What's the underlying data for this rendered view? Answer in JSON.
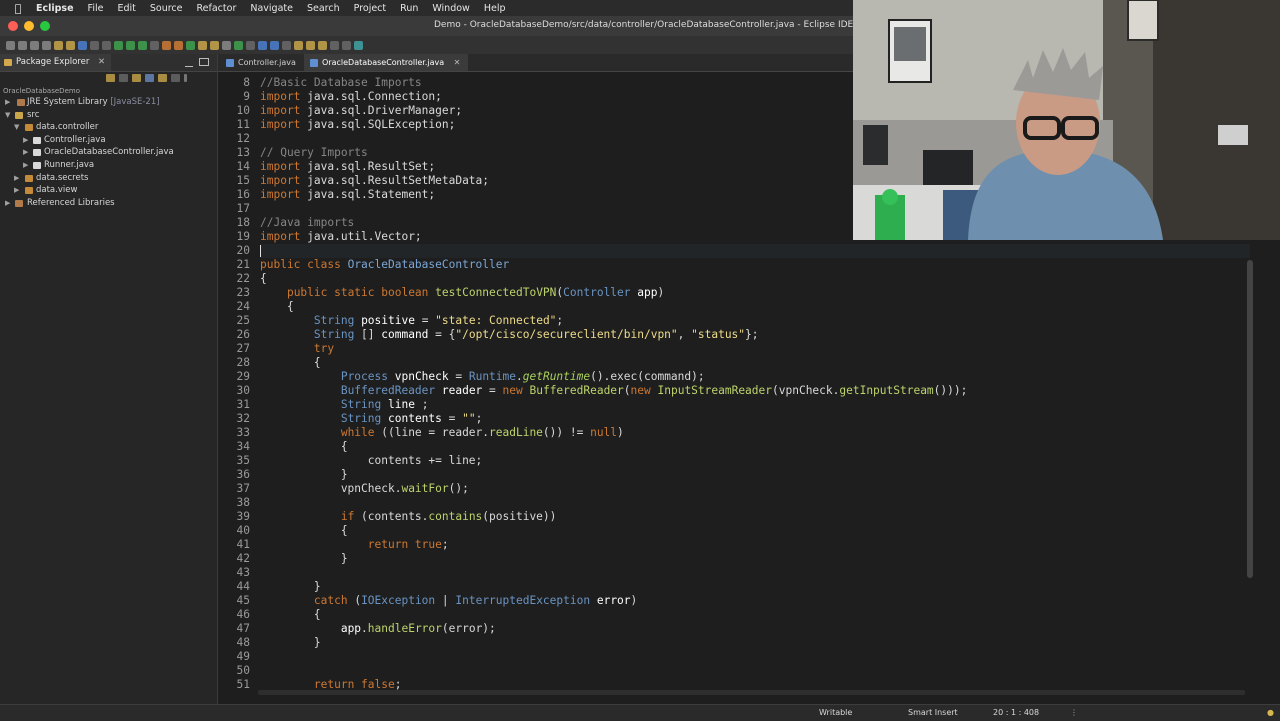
{
  "menubar": {
    "app": "Eclipse",
    "items": [
      "File",
      "Edit",
      "Source",
      "Refactor",
      "Navigate",
      "Search",
      "Project",
      "Run",
      "Window",
      "Help"
    ]
  },
  "window": {
    "title": "Demo - OracleDatabaseDemo/src/data/controller/OracleDatabaseController.java - Eclipse IDE"
  },
  "package_explorer": {
    "tab_label": "Package Explorer",
    "project": "OracleDatabaseDemo",
    "tree": [
      {
        "label": "JRE System Library",
        "suffix": "[JavaSE-21]"
      },
      {
        "label": "src"
      },
      {
        "label": "data.controller"
      },
      {
        "label": "Controller.java"
      },
      {
        "label": "OracleDatabaseController.java"
      },
      {
        "label": "Runner.java"
      },
      {
        "label": "data.secrets"
      },
      {
        "label": "data.view"
      },
      {
        "label": "Referenced Libraries"
      }
    ]
  },
  "editor": {
    "tabs": [
      {
        "label": "Controller.java"
      },
      {
        "label": "OracleDatabaseController.java"
      }
    ],
    "line_numbers": [
      "8",
      "9",
      "10",
      "11",
      "12",
      "13",
      "14",
      "15",
      "16",
      "17",
      "18",
      "19",
      "20",
      "21",
      "22",
      "23",
      "24",
      "25",
      "26",
      "27",
      "28",
      "29",
      "30",
      "31",
      "32",
      "33",
      "34",
      "35",
      "36",
      "37",
      "38",
      "39",
      "40",
      "41",
      "42",
      "43",
      "44",
      "45",
      "46",
      "47",
      "48",
      "49",
      "50",
      "51"
    ]
  },
  "statusbar": {
    "mode": "Writable",
    "insert": "Smart Insert",
    "position": "20 : 1 : 408"
  },
  "colors": {
    "keyword": "#cc7832",
    "comment": "#858585",
    "type": "#6a94c2",
    "string": "#eedc8a",
    "method": "#bcd36b"
  }
}
